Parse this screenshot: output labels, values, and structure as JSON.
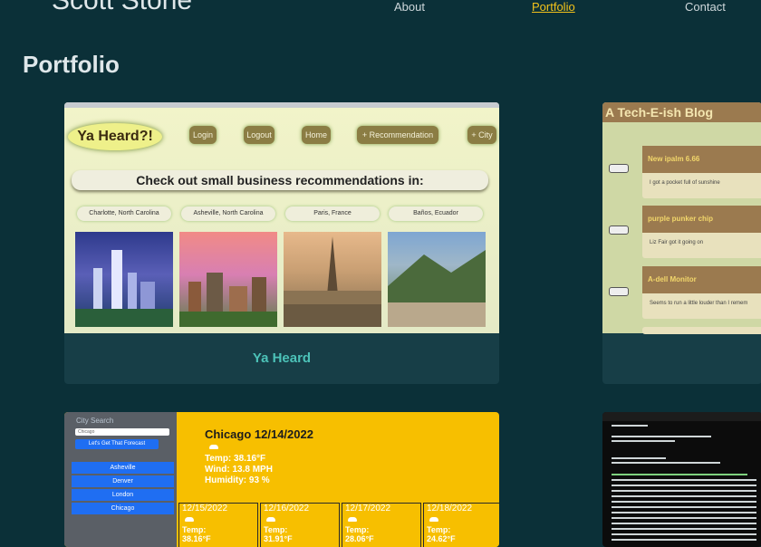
{
  "header": {
    "site_name": "Scott Stone",
    "nav": [
      {
        "label": "About",
        "active": false
      },
      {
        "label": "Portfolio",
        "active": true
      },
      {
        "label": "Contact",
        "active": false
      }
    ]
  },
  "section_title": "Portfolio",
  "projects": [
    {
      "name": "Ya Heard",
      "screenshot": {
        "logo": "Ya Heard?!",
        "buttons": [
          "Login",
          "Logout",
          "Home",
          "+ Recommendation",
          "+ City"
        ],
        "banner": "Check out small business recommendations in:",
        "cities": [
          "Charlotte, North Carolina",
          "Asheville, North Carolina",
          "Paris, France",
          "Baños, Ecuador"
        ]
      }
    },
    {
      "name": "",
      "screenshot": {
        "title": "A Tech-E-ish Blog",
        "posts": [
          {
            "title": "New ipalm 6.66",
            "body": "I got a pocket full of sunshine"
          },
          {
            "title": "purple punker chip",
            "body": "Liz Fair got it going on"
          },
          {
            "title": "A-dell Monitor",
            "body": "Seems to run a little louder than I remem"
          }
        ]
      }
    },
    {
      "name": "",
      "screenshot": {
        "search_label": "City Search",
        "search_value": "Chicago",
        "search_button": "Let's Get That Forecast",
        "cities": [
          "Asheville",
          "Denver",
          "London",
          "Chicago"
        ],
        "current": {
          "heading": "Chicago 12/14/2022",
          "temp": "Temp: 38.16°F",
          "wind": "Wind: 13.8 MPH",
          "humidity": "Humidity: 93 %"
        },
        "forecast": [
          {
            "date": "12/15/2022",
            "temp": "38.16°F"
          },
          {
            "date": "12/16/2022",
            "temp": "31.91°F"
          },
          {
            "date": "12/17/2022",
            "temp": "28.06°F"
          },
          {
            "date": "12/18/2022",
            "temp": "24.62°F"
          }
        ],
        "temp_label": "Temp:"
      }
    },
    {
      "name": "",
      "screenshot": {}
    }
  ]
}
